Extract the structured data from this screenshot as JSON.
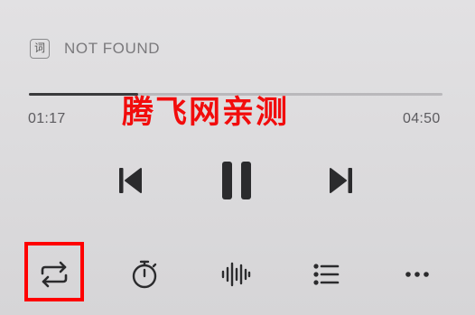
{
  "lyrics": {
    "badge_label": "词",
    "status_text": "NOT FOUND"
  },
  "progress": {
    "elapsed": "01:17",
    "total": "04:50",
    "fraction": 0.265
  },
  "watermark": {
    "text": "腾飞网亲测",
    "color": "#f20c0c"
  },
  "controls": {
    "previous_icon": "skip-previous-icon",
    "pause_icon": "pause-icon",
    "next_icon": "skip-next-icon"
  },
  "bottom_bar": {
    "icons": [
      "repeat-icon",
      "timer-icon",
      "sound-effects-icon",
      "playlist-icon",
      "more-icon"
    ],
    "highlighted": "repeat-icon",
    "highlight_color": "#ff0000"
  },
  "colors": {
    "icon": "#2b2b2d",
    "track": "#b9b8bb",
    "fill": "#3a3a3c"
  }
}
